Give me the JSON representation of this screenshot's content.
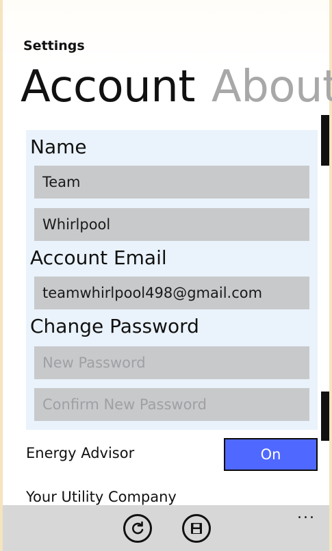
{
  "header": {
    "app_title": "Settings",
    "tabs": [
      {
        "label": "Account",
        "state": "active"
      },
      {
        "label": "About",
        "state": "inactive"
      }
    ]
  },
  "account": {
    "name_label": "Name",
    "first_name": "Team",
    "last_name": "Whirlpool",
    "email_label": "Account Email",
    "email": "teamwhirlpool498@gmail.com",
    "password_label": "Change Password",
    "new_password_placeholder": "New Password",
    "confirm_password_placeholder": "Confirm New Password"
  },
  "settings": {
    "energy_advisor_label": "Energy Advisor",
    "energy_advisor_value": "On",
    "utility_label": "Your Utility Company"
  },
  "appbar": {
    "buttons": [
      {
        "icon": "refresh-icon"
      },
      {
        "icon": "save-icon"
      }
    ],
    "more": "..."
  },
  "colors": {
    "toggle_accent": "#4f68ff",
    "panel_bg": "#eaf3fb",
    "field_bg": "#c8c9cb",
    "appbar_bg": "#d7d7d7"
  }
}
